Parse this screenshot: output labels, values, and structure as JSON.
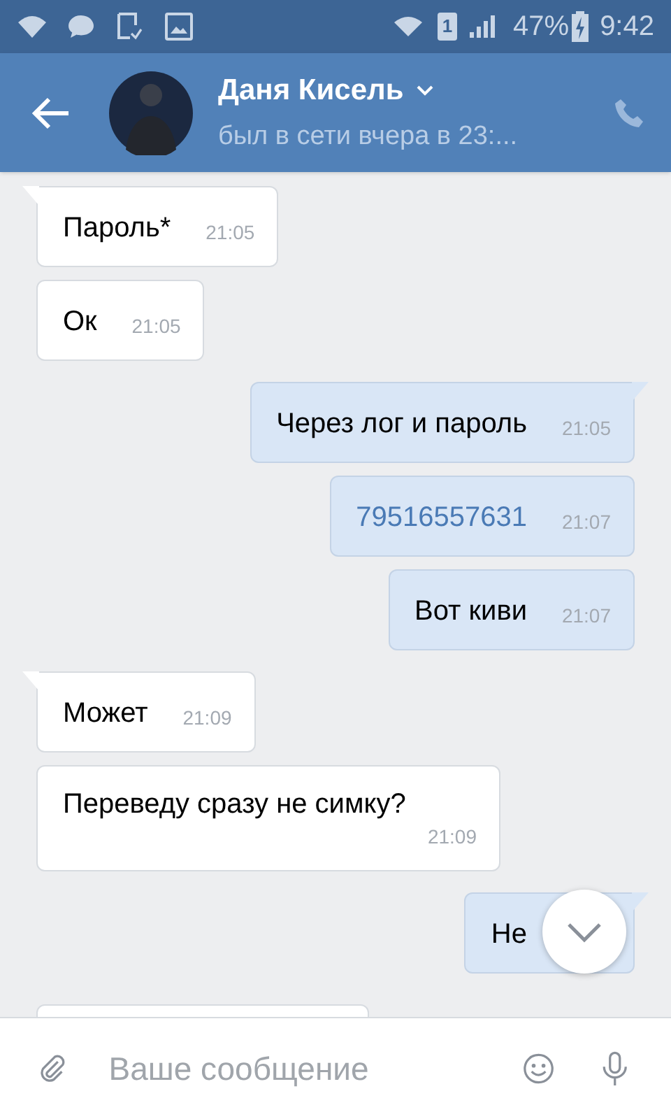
{
  "status_bar": {
    "sim": "1",
    "battery": "47%",
    "time": "9:42"
  },
  "header": {
    "name": "Даня Кисель",
    "status": "был в сети вчера в 23:..."
  },
  "messages": [
    {
      "kind": "incoming",
      "tail": true,
      "text": "Пароль*",
      "time": "21:05"
    },
    {
      "kind": "incoming",
      "tail": false,
      "text": "Ок",
      "time": "21:05"
    },
    {
      "kind": "outgoing",
      "tail": true,
      "text": "Через лог и пароль",
      "time": "21:05"
    },
    {
      "kind": "outgoing",
      "tail": false,
      "link": true,
      "text": "79516557631",
      "time": "21:07"
    },
    {
      "kind": "outgoing",
      "tail": false,
      "text": "Вот киви",
      "time": "21:07"
    },
    {
      "kind": "incoming",
      "tail": true,
      "text": "Может",
      "time": "21:09"
    },
    {
      "kind": "incoming",
      "tail": false,
      "text": "Переведу сразу не симку?",
      "time": "21:09"
    },
    {
      "kind": "outgoing",
      "tail": true,
      "text": "Не"
    }
  ],
  "composer": {
    "placeholder": "Ваше сообщение"
  }
}
